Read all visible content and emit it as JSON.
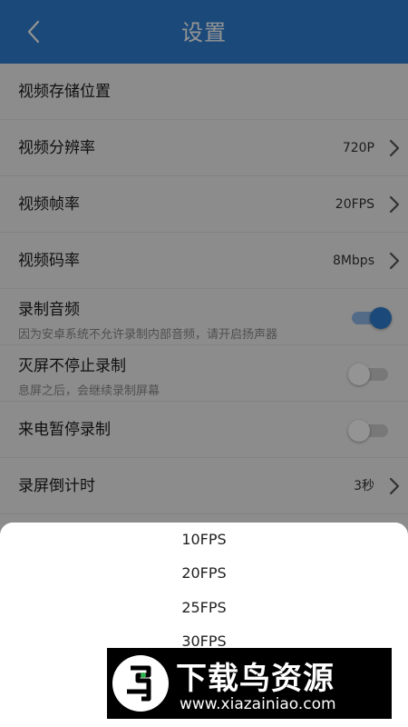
{
  "header": {
    "title": "设置",
    "back_icon": "chevron-left-icon"
  },
  "settings": [
    {
      "label": "视频存储位置"
    },
    {
      "label": "视频分辨率",
      "value": "720P"
    },
    {
      "label": "视频帧率",
      "value": "20FPS"
    },
    {
      "label": "视频码率",
      "value": "8Mbps"
    },
    {
      "label": "录制音频",
      "subtext": "因为安卓系统不允许录制内部音频，请开启扬声器",
      "toggle": "on"
    },
    {
      "label": "灭屏不停止录制",
      "subtext": "息屏之后，会继续录制屏幕",
      "toggle": "off"
    },
    {
      "label": "来电暂停录制",
      "toggle": "off"
    },
    {
      "label": "录屏倒计时",
      "value": "3秒"
    }
  ],
  "picker": {
    "options": [
      "10FPS",
      "20FPS",
      "25FPS",
      "30FPS"
    ]
  },
  "watermark": {
    "brand": "下载鸟资源",
    "url": "www.xiazainiao.com"
  },
  "colors": {
    "accent": "#2f7fd1",
    "toggle_on_track": "#8fb9e8",
    "toggle_off_track": "#cfcfcf"
  }
}
